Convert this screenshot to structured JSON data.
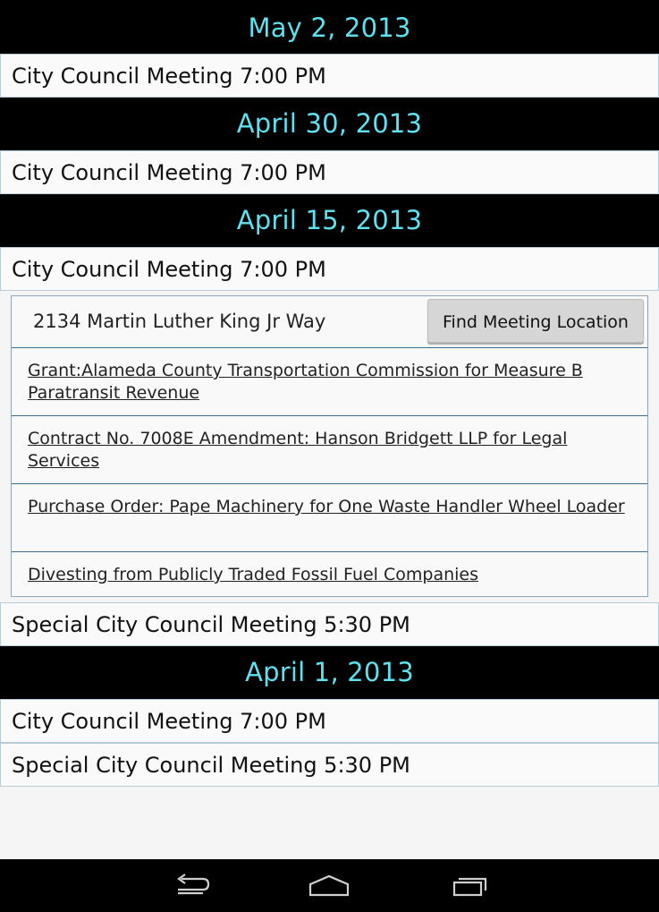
{
  "meetings": [
    {
      "date": "May 2, 2013",
      "events": [
        {
          "title": "City Council Meeting 7:00 PM"
        }
      ]
    },
    {
      "date": "April 30, 2013",
      "events": [
        {
          "title": "City Council Meeting 7:00 PM"
        }
      ]
    },
    {
      "date": "April 15, 2013",
      "events": [
        {
          "title": "City Council Meeting 7:00 PM"
        },
        {
          "title": "Special City Council Meeting 5:30 PM"
        }
      ],
      "expanded": {
        "location": "2134 Martin Luther King Jr Way",
        "find_button": "Find Meeting Location",
        "agenda_items": [
          "Grant:Alameda County Transportation Commission for Measure B Paratransit Revenue",
          "Contract No. 7008E Amendment: Hanson Bridgett LLP for Legal Services",
          "Purchase Order: Pape Machinery for One Waste Handler Wheel Loader",
          "Divesting from Publicly Traded Fossil Fuel Companies"
        ]
      }
    },
    {
      "date": "April 1, 2013",
      "events": [
        {
          "title": "City Council Meeting 7:00 PM"
        },
        {
          "title": "Special City Council Meeting 5:30 PM"
        }
      ]
    }
  ],
  "navbar": {
    "back_icon": "back-icon",
    "home_icon": "home-icon",
    "recents_icon": "recent-apps-icon"
  },
  "colors": {
    "header_bg": "#000000",
    "header_text": "#5ee0ee",
    "row_border": "#b7ccd8"
  }
}
